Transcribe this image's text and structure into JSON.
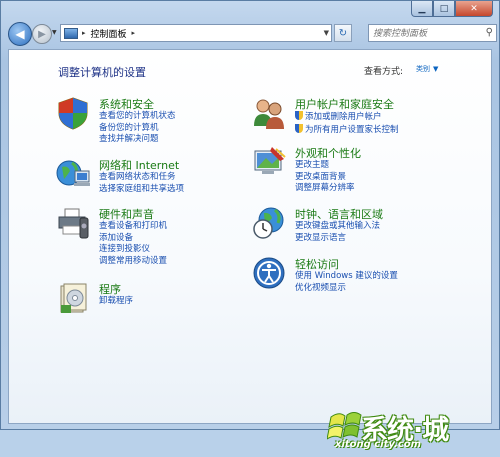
{
  "window": {
    "minimize_glyph": "▁",
    "maximize_glyph": "□",
    "close_glyph": "✕"
  },
  "nav": {
    "back_glyph": "◀",
    "forward_glyph": "▶",
    "history_glyph": "▼",
    "breadcrumb": "控制面板",
    "breadcrumb_sep": "▸",
    "refresh_glyph": "↻",
    "search_placeholder": "搜索控制面板",
    "search_glyph": "⚲"
  },
  "main": {
    "heading": "调整计算机的设置",
    "view_by_label": "查看方式:",
    "view_by_value": "类别"
  },
  "categories": [
    {
      "title": "系统和安全",
      "links": [
        "查看您的计算机状态",
        "备份您的计算机",
        "查找并解决问题"
      ]
    },
    {
      "title": "网络和 Internet",
      "links": [
        "查看网络状态和任务",
        "选择家庭组和共享选项"
      ]
    },
    {
      "title": "硬件和声音",
      "links": [
        "查看设备和打印机",
        "添加设备",
        "连接到投影仪",
        "调整常用移动设置"
      ]
    },
    {
      "title": "程序",
      "links": [
        "卸载程序"
      ]
    },
    {
      "title": "用户帐户和家庭安全",
      "links": [
        "添加或删除用户帐户",
        "为所有用户设置家长控制"
      ]
    },
    {
      "title": "外观和个性化",
      "links": [
        "更改主题",
        "更改桌面背景",
        "调整屏幕分辨率"
      ]
    },
    {
      "title": "时钟、语言和区域",
      "links": [
        "更改键盘或其他输入法",
        "更改显示语言"
      ]
    },
    {
      "title": "轻松访问",
      "links": [
        "使用 Windows 建议的设置",
        "优化视频显示"
      ]
    }
  ],
  "watermark": {
    "text": "系统·城",
    "domain": "xitong city.com"
  },
  "colors": {
    "link": "#1a4fb0",
    "category_title": "#1a7a14",
    "heading": "#1e3287"
  }
}
